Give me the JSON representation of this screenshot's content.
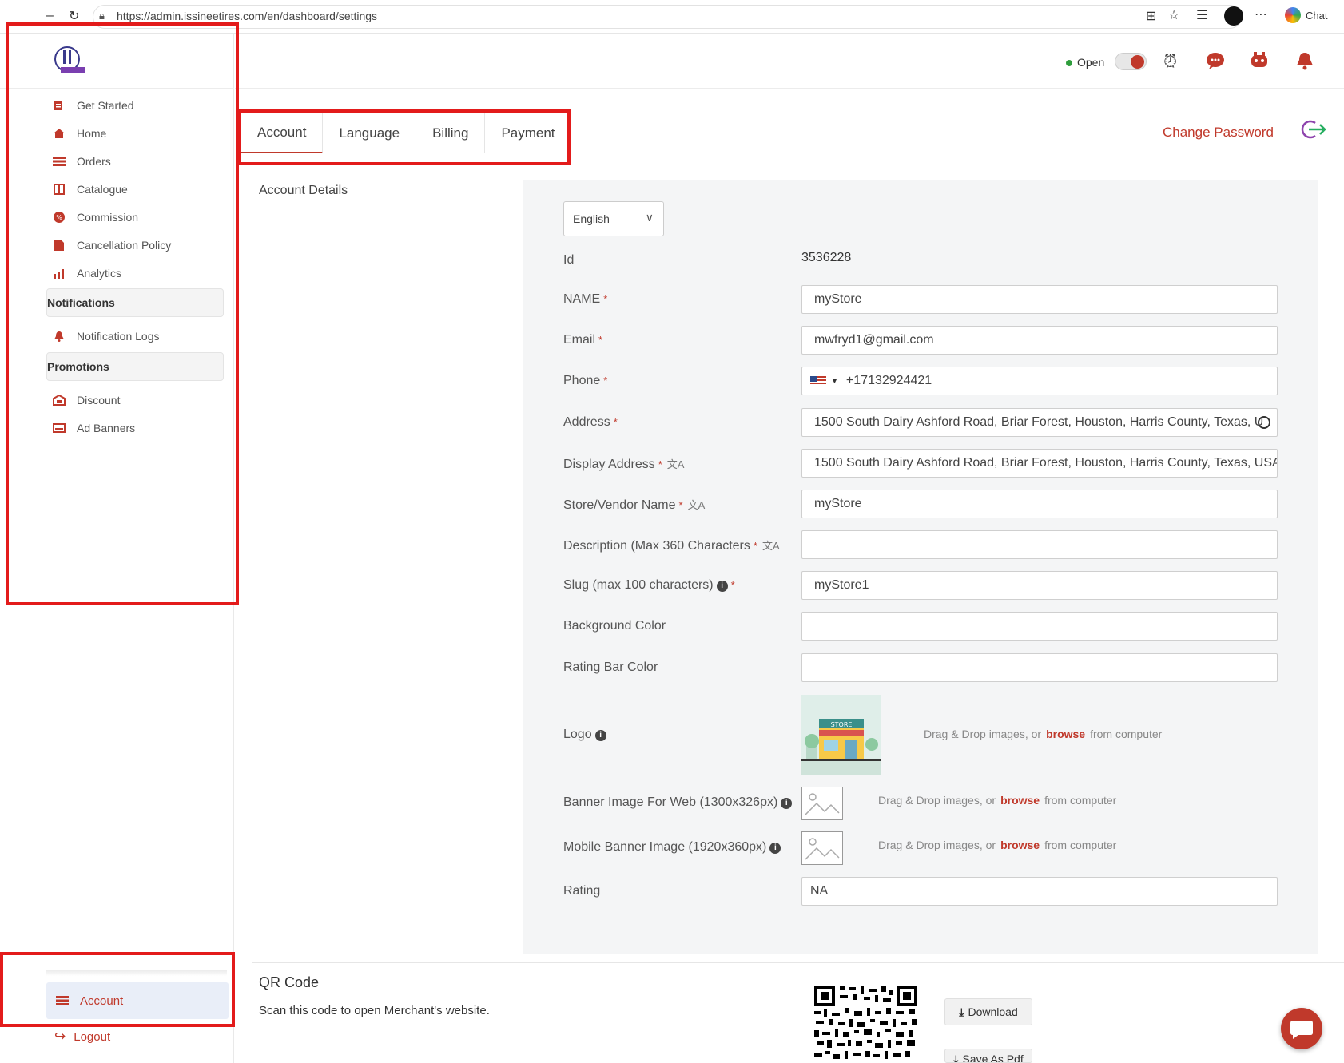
{
  "browser": {
    "url": "https://admin.issineetires.com/en/dashboard/settings",
    "chat_label": "Chat"
  },
  "sidebar": {
    "items": [
      {
        "label": "Get Started",
        "icon": "edit-icon"
      },
      {
        "label": "Home",
        "icon": "home-icon"
      },
      {
        "label": "Orders",
        "icon": "list-icon"
      },
      {
        "label": "Catalogue",
        "icon": "book-icon"
      },
      {
        "label": "Commission",
        "icon": "percent-icon"
      },
      {
        "label": "Cancellation Policy",
        "icon": "document-icon"
      },
      {
        "label": "Analytics",
        "icon": "chart-icon"
      }
    ],
    "sections": {
      "notifications": "Notifications",
      "promotions": "Promotions"
    },
    "notification_items": [
      {
        "label": "Notification Logs",
        "icon": "bell-icon"
      }
    ],
    "promotion_items": [
      {
        "label": "Discount",
        "icon": "discount-icon"
      },
      {
        "label": "Ad Banners",
        "icon": "banner-icon"
      }
    ],
    "account_label": "Account",
    "logout_label": "Logout"
  },
  "header": {
    "status_label": "Open",
    "status_on": true
  },
  "tabs": [
    {
      "label": "Account",
      "active": true
    },
    {
      "label": "Language",
      "active": false
    },
    {
      "label": "Billing",
      "active": false
    },
    {
      "label": "Payment",
      "active": false
    }
  ],
  "change_password_label": "Change Password",
  "account_details_title": "Account Details",
  "form": {
    "language": "English",
    "id_label": "Id",
    "id_value": "3536228",
    "name_label": "NAME",
    "name_value": "myStore",
    "email_label": "Email",
    "email_value": "mwfryd1@gmail.com",
    "phone_label": "Phone",
    "phone_value": "+17132924421",
    "address_label": "Address",
    "address_value": "1500 South Dairy Ashford Road, Briar Forest, Houston, Harris County, Texas, U",
    "display_address_label": "Display Address",
    "display_address_value": "1500 South Dairy Ashford Road, Briar Forest, Houston, Harris County, Texas, USA",
    "store_name_label": "Store/Vendor Name",
    "store_name_value": "myStore",
    "description_label": "Description (Max 360 Characters",
    "description_value": "",
    "slug_label": "Slug (max 100 characters)",
    "slug_value": "myStore1",
    "bg_color_label": "Background Color",
    "bg_color_value": "",
    "rating_bar_label": "Rating Bar Color",
    "rating_bar_value": "",
    "logo_label": "Logo",
    "banner_web_label": "Banner Image For Web (1300x326px)",
    "banner_mobile_label": "Mobile Banner Image (1920x360px)",
    "rating_label": "Rating",
    "rating_value": "NA",
    "drop_prefix": "Drag & Drop images, or",
    "drop_browse": "browse",
    "drop_suffix": "from computer",
    "store_sign": "STORE"
  },
  "qr": {
    "title": "QR Code",
    "subtitle": "Scan this code to open Merchant's website.",
    "download_label": "Download",
    "save_pdf_label": "Save As Pdf"
  },
  "colors": {
    "accent": "#c0392b",
    "annotation_red": "#e31b1b",
    "panel_bg": "#f4f5f6"
  }
}
